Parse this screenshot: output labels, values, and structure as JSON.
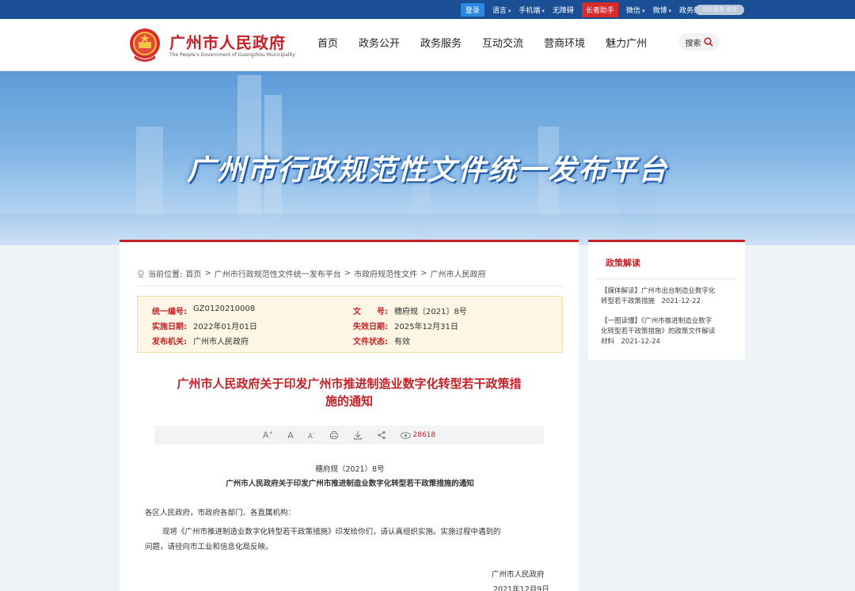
{
  "topbar": {
    "login": "登录",
    "links": [
      "语言",
      "手机端",
      "无障碍",
      "长者助手",
      "微信",
      "微博",
      "政务邮箱"
    ],
    "pill": "市民服务 政务"
  },
  "header": {
    "site_name": "广州市人民政府",
    "site_name_en": "The People's Government of Guangzhou Municipality",
    "nav": [
      "首页",
      "政务公开",
      "政务服务",
      "互动交流",
      "营商环境",
      "魅力广州"
    ],
    "search": "搜索"
  },
  "banner": {
    "title": "广州市行政规范性文件统一发布平台"
  },
  "breadcrumb": {
    "label": "当前位置:",
    "items": [
      "首页",
      "广州市行政规范性文件统一发布平台",
      "市政府规范性文件",
      "广州市人民政府"
    ],
    "sep": ">"
  },
  "meta": {
    "serial_k": "统一编号:",
    "serial_v": "GZ0120210008",
    "docno_k": "文　　号:",
    "docno_v": "穗府规〔2021〕8号",
    "impl_k": "实施日期:",
    "impl_v": "2022年01月01日",
    "expire_k": "失效日期:",
    "expire_v": "2025年12月31日",
    "org_k": "发布机关:",
    "org_v": "广州市人民政府",
    "status_k": "文件状态:",
    "status_v": "有效"
  },
  "doc": {
    "title_line1": "广州市人民政府关于印发广州市推进制造业数字化转型若干政策措",
    "title_line2": "施的通知",
    "views": "28618",
    "docno": "穗府规（2021）8号",
    "subtitle": "广州市人民政府关于印发广州市推进制造业数字化转型若干政策措施的通知",
    "addressee": "各区人民政府，市政府各部门、各直属机构：",
    "para1_a": "现将《广州市推进制造业数字化转型若干政策措施》印发给你们，请认真组织实施。实施过程中遇到的",
    "para1_b": "问题，请径向市工业和信息化局反映。",
    "sign": "广州市人民政府",
    "date": "2021年12月9日"
  },
  "side": {
    "title": "政策解读",
    "items": [
      {
        "line1": "【媒体解读】广州市出台制造业数字化",
        "line2": "转型若干政策措施　2021-12-22"
      },
      {
        "line1": "【一图读懂】《广州市推进制造业数字",
        "line2": "化转型若干政策措施》的政策文件解读",
        "line3": "材料　2021-12-24"
      }
    ]
  },
  "colors": {
    "brand_red": "#c62127",
    "top_bar": "#1a4f96"
  }
}
